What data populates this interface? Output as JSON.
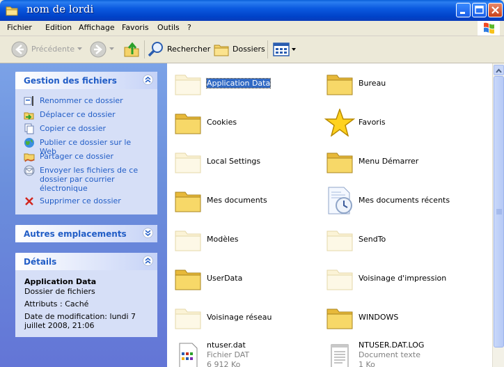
{
  "window": {
    "title": "nom de lordi"
  },
  "menu": [
    "Fichier",
    "Edition",
    "Affichage",
    "Favoris",
    "Outils",
    "?"
  ],
  "toolbar": {
    "back_label": "Précédente",
    "search_label": "Rechercher",
    "folders_label": "Dossiers"
  },
  "file_management": {
    "title": "Gestion des fichiers",
    "tasks": [
      {
        "label": "Renommer ce dossier",
        "icon": "rename-icon"
      },
      {
        "label": "Déplacer ce dossier",
        "icon": "move-icon"
      },
      {
        "label": "Copier ce dossier",
        "icon": "copy-icon"
      },
      {
        "label": "Publier ce dossier sur le Web",
        "icon": "globe-icon"
      },
      {
        "label": "Partager ce dossier",
        "icon": "share-icon"
      },
      {
        "label": "Envoyer les fichiers de ce dossier par courrier électronique",
        "icon": "email-icon"
      },
      {
        "label": "Supprimer ce dossier",
        "icon": "delete-icon"
      }
    ]
  },
  "other_places": {
    "title": "Autres emplacements"
  },
  "details": {
    "title": "Détails",
    "name": "Application Data",
    "type": "Dossier de fichiers",
    "attributes": "Attributs : Caché",
    "modified": "Date de modification: lundi 7 juillet 2008, 21:06"
  },
  "files": [
    {
      "name": "Application Data",
      "icon": "folder-hidden-icon",
      "selected": true
    },
    {
      "name": "Bureau",
      "icon": "folder-icon"
    },
    {
      "name": "Cookies",
      "icon": "folder-icon"
    },
    {
      "name": "Favoris",
      "icon": "star-icon"
    },
    {
      "name": "Local Settings",
      "icon": "folder-hidden-icon"
    },
    {
      "name": "Menu Démarrer",
      "icon": "folder-icon"
    },
    {
      "name": "Mes documents",
      "icon": "folder-icon"
    },
    {
      "name": "Mes documents récents",
      "icon": "recent-documents-icon"
    },
    {
      "name": "Modèles",
      "icon": "folder-hidden-icon"
    },
    {
      "name": "SendTo",
      "icon": "folder-hidden-icon"
    },
    {
      "name": "UserData",
      "icon": "folder-icon"
    },
    {
      "name": "Voisinage d'impression",
      "icon": "folder-hidden-icon"
    },
    {
      "name": "Voisinage réseau",
      "icon": "folder-hidden-icon"
    },
    {
      "name": "WINDOWS",
      "icon": "folder-icon"
    },
    {
      "name": "ntuser.dat",
      "icon": "dat-file-icon",
      "sub1": "Fichier DAT",
      "sub2": "6 912 Ko"
    },
    {
      "name": "NTUSER.DAT.LOG",
      "icon": "text-document-icon",
      "sub1": "Document texte",
      "sub2": "1 Ko"
    }
  ],
  "colors": {
    "title_bar": "#0a5fd8",
    "task_pane": "#6b8fdc",
    "link": "#215dc6",
    "selection": "#316ac5"
  }
}
